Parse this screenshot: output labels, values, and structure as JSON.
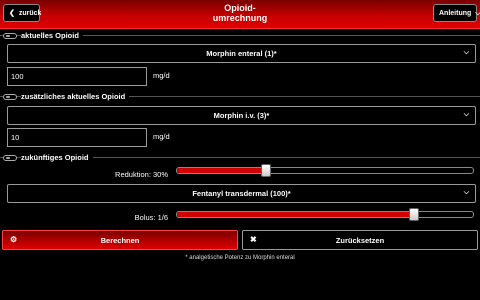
{
  "header": {
    "back_label": "zurück",
    "title_line1": "Opioid-",
    "title_line2": "umrechnung",
    "menu_label": "Anleitung"
  },
  "current": {
    "section_label": "aktuelles Opioid",
    "select_value": "Morphin enteral (1)*",
    "dose_value": "100",
    "unit": "mg/d"
  },
  "additional": {
    "section_label": "zusätzliches aktuelles Opioid",
    "select_value": "Morphin i.v. (3)*",
    "dose_value": "10",
    "unit": "mg/d"
  },
  "future": {
    "section_label": "zukünftiges Opioid",
    "reduction_label": "Reduktion: 30%",
    "reduction_fraction": 0.3,
    "select_value": "Fentanyl transdermal (100)*",
    "bolus_label": "Bolus: 1/6",
    "bolus_fraction": 0.8
  },
  "actions": {
    "calc_label": "Berechnen",
    "reset_label": "Zurücksetzen"
  },
  "footnote": "* analgetische Potenz zu Morphin enteral",
  "colors": {
    "accent": "#e00000",
    "background": "#000000"
  }
}
